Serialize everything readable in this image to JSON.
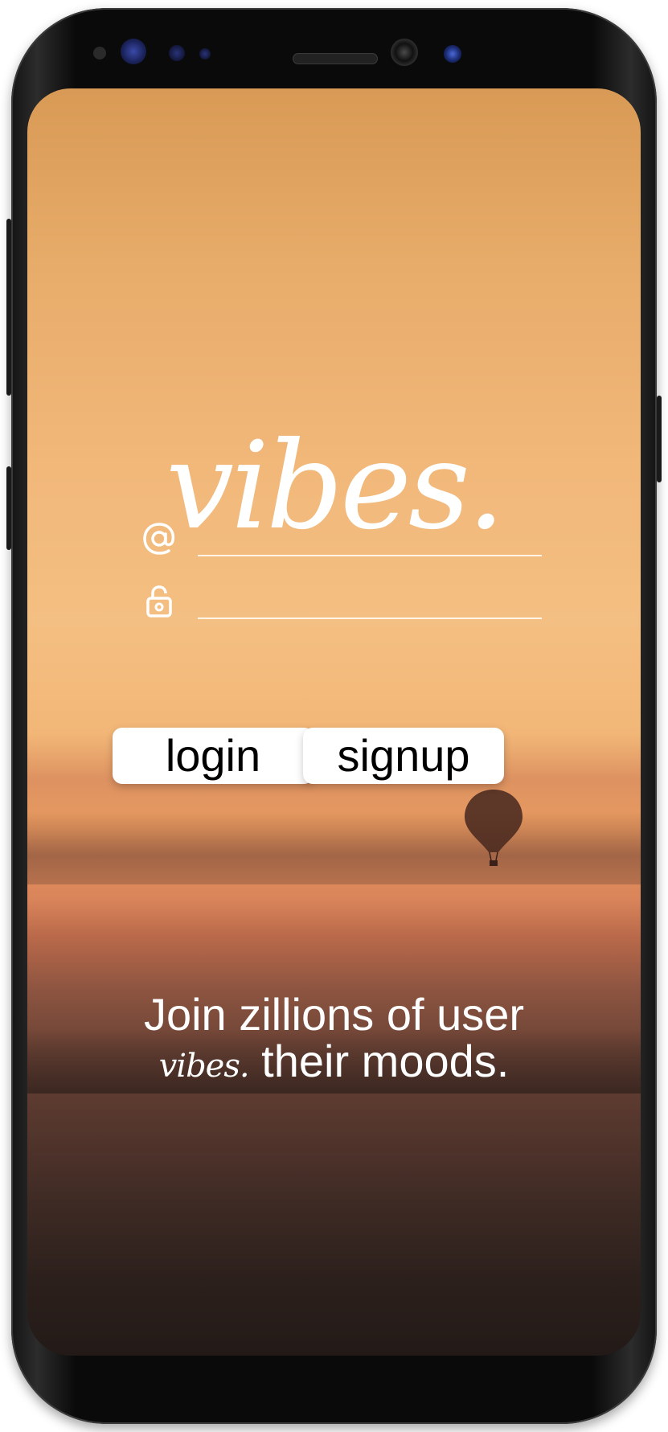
{
  "app": {
    "logo_text": "vibes."
  },
  "login_form": {
    "email_icon": "at-sign-icon",
    "email_value": "",
    "password_icon": "lock-icon",
    "password_value": "",
    "login_label": "login",
    "signup_label": "signup"
  },
  "tagline": {
    "line1": "Join zillions of user",
    "logo_word": "vibes.",
    "line2_rest": " their moods."
  },
  "colors": {
    "text": "#ffffff",
    "button_bg": "#ffffff",
    "button_text": "#000000",
    "sky_top": "#d89a55",
    "sky_mid": "#f4bf82",
    "ground": "#231a17"
  }
}
